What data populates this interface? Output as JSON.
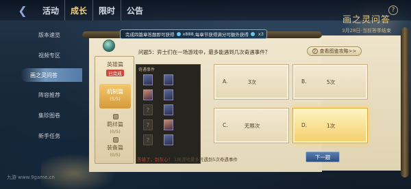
{
  "nav": {
    "tabs": [
      "活动",
      "成长",
      "限时",
      "公告"
    ],
    "active_index": 1
  },
  "event": {
    "title": "画之灵问答",
    "subtitle": "3月28日-当前答季结束",
    "help": "?"
  },
  "left_menu": {
    "items": [
      "版本速览",
      "视频专区",
      "画之灵问答",
      "阵容推荐",
      "集珍图卷",
      "新手任务"
    ],
    "active_index": 2
  },
  "reward_bar": {
    "text_a": "完成四篇章答题即可获得",
    "amount": "x888",
    "text_b": ",每章节获得满分可额外获得",
    "bonus": "x3"
  },
  "categories": [
    {
      "name": "英雄篇",
      "badge": "已完成"
    },
    {
      "name": "机制篇",
      "progress": "(5/5)"
    },
    {
      "name": "羁绊篇",
      "progress": "(0/5)"
    },
    {
      "name": "装备篇",
      "progress": "(0/5)"
    }
  ],
  "grid": {
    "title": "奇遇事件",
    "unknown": "?"
  },
  "question": {
    "text": "问题5：弈士们在一场游戏中，最多能遇到几次奇遇事件？",
    "tip_button": "查看图鉴攻略>>"
  },
  "options": [
    {
      "letter": "A.",
      "text": "3次"
    },
    {
      "letter": "B.",
      "text": "5次"
    },
    {
      "letter": "C.",
      "text": "无限次"
    },
    {
      "letter": "D.",
      "text": "1次"
    }
  ],
  "selected_option": 3,
  "answer": {
    "wrong": "答错了，别灰心！",
    "explain": "1局游戏最多可遇到5次奇遇事件"
  },
  "next_button": "下一题",
  "watermark": "九游 www.9game.cn",
  "colors": {
    "accent_gold": "#f0d08a",
    "wrong_red": "#b8452f",
    "selected_option": "#f4cf6b",
    "next_button": "#2f4e7e"
  }
}
